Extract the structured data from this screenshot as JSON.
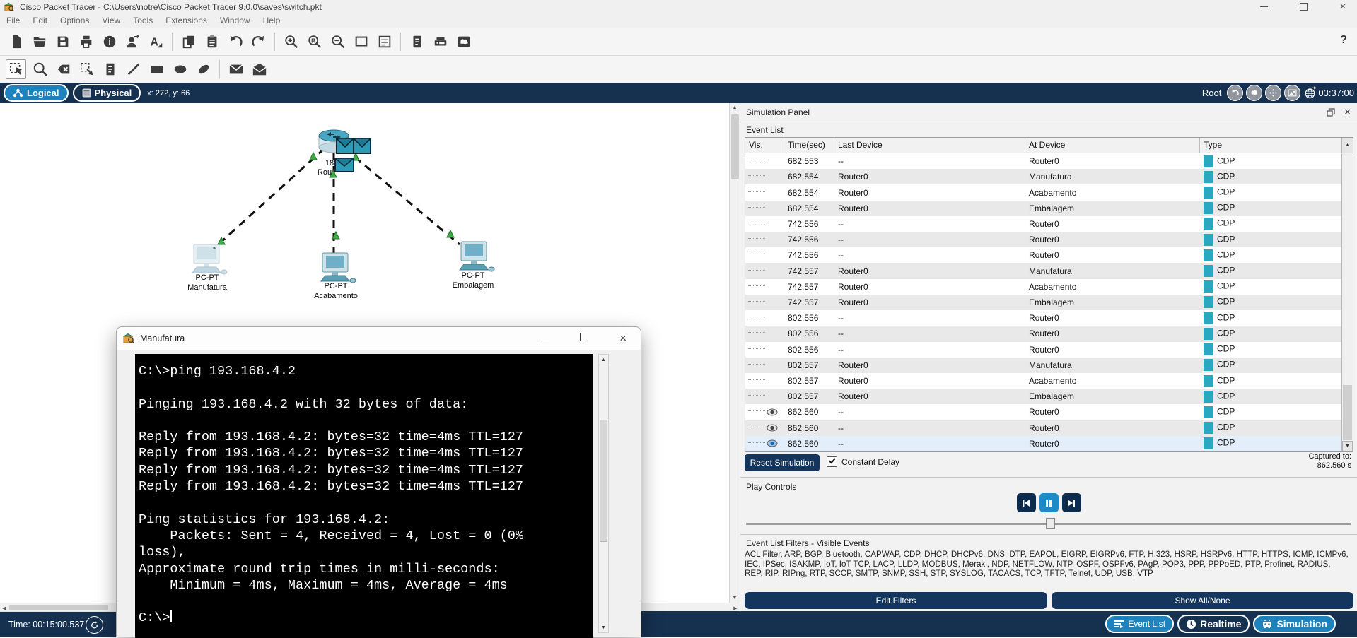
{
  "app": {
    "title": "Cisco Packet Tracer - C:\\Users\\notre\\Cisco Packet Tracer 9.0.0\\saves\\switch.pkt",
    "help_label": "?"
  },
  "menu": {
    "items": [
      "File",
      "Edit",
      "Options",
      "View",
      "Tools",
      "Extensions",
      "Window",
      "Help"
    ]
  },
  "toolbar_main": {
    "icons": [
      "new-file",
      "open-file",
      "save",
      "print",
      "activity-wizard",
      "user-profile",
      "font-settings",
      "|",
      "copy",
      "paste",
      "undo",
      "redo",
      "|",
      "zoom-in",
      "zoom-reset",
      "zoom-out",
      "drawing-palette",
      "custom-devices",
      "|",
      "network-info",
      "device-console",
      "environment"
    ]
  },
  "toolbar_draw": {
    "icons": [
      "select",
      "inspect",
      "delete",
      "resize-shape",
      "place-note",
      "draw-line",
      "draw-rectangle",
      "draw-ellipse",
      "draw-freeform",
      "|",
      "add-simple-pdu",
      "add-complex-pdu"
    ]
  },
  "workspace_bar": {
    "logical": "Logical",
    "physical": "Physical",
    "coords": "x: 272, y: 66",
    "root": "Root",
    "clock": "03:37:00"
  },
  "topology": {
    "router": {
      "label_model_visible": "18",
      "label_name_visible": "Rou"
    },
    "pcs": [
      {
        "type_label": "PC-PT",
        "name": "Manufatura"
      },
      {
        "type_label": "PC-PT",
        "name": "Acabamento"
      },
      {
        "type_label": "PC-PT",
        "name": "Embalagem"
      }
    ]
  },
  "terminal_window": {
    "title": "Manufatura",
    "lines": [
      "C:\\>ping 193.168.4.2",
      "",
      "Pinging 193.168.4.2 with 32 bytes of data:",
      "",
      "Reply from 193.168.4.2: bytes=32 time=4ms TTL=127",
      "Reply from 193.168.4.2: bytes=32 time=4ms TTL=127",
      "Reply from 193.168.4.2: bytes=32 time=4ms TTL=127",
      "Reply from 193.168.4.2: bytes=32 time=4ms TTL=127",
      "",
      "Ping statistics for 193.168.4.2:",
      "    Packets: Sent = 4, Received = 4, Lost = 0 (0%",
      "loss),",
      "Approximate round trip times in milli-seconds:",
      "    Minimum = 4ms, Maximum = 4ms, Average = 4ms",
      "",
      "C:\\>"
    ]
  },
  "simulation_panel": {
    "title": "Simulation Panel",
    "event_list_label": "Event List",
    "columns": [
      "Vis.",
      "Time(sec)",
      "Last Device",
      "At Device",
      "Type"
    ],
    "type_color": "#29a8c0",
    "events": [
      {
        "time": "682.553",
        "last": "--",
        "at": "Router0",
        "type": "CDP",
        "eye": false
      },
      {
        "time": "682.554",
        "last": "Router0",
        "at": "Manufatura",
        "type": "CDP",
        "eye": false
      },
      {
        "time": "682.554",
        "last": "Router0",
        "at": "Acabamento",
        "type": "CDP",
        "eye": false
      },
      {
        "time": "682.554",
        "last": "Router0",
        "at": "Embalagem",
        "type": "CDP",
        "eye": false
      },
      {
        "time": "742.556",
        "last": "--",
        "at": "Router0",
        "type": "CDP",
        "eye": false
      },
      {
        "time": "742.556",
        "last": "--",
        "at": "Router0",
        "type": "CDP",
        "eye": false
      },
      {
        "time": "742.556",
        "last": "--",
        "at": "Router0",
        "type": "CDP",
        "eye": false
      },
      {
        "time": "742.557",
        "last": "Router0",
        "at": "Manufatura",
        "type": "CDP",
        "eye": false
      },
      {
        "time": "742.557",
        "last": "Router0",
        "at": "Acabamento",
        "type": "CDP",
        "eye": false
      },
      {
        "time": "742.557",
        "last": "Router0",
        "at": "Embalagem",
        "type": "CDP",
        "eye": false
      },
      {
        "time": "802.556",
        "last": "--",
        "at": "Router0",
        "type": "CDP",
        "eye": false
      },
      {
        "time": "802.556",
        "last": "--",
        "at": "Router0",
        "type": "CDP",
        "eye": false
      },
      {
        "time": "802.556",
        "last": "--",
        "at": "Router0",
        "type": "CDP",
        "eye": false
      },
      {
        "time": "802.557",
        "last": "Router0",
        "at": "Manufatura",
        "type": "CDP",
        "eye": false
      },
      {
        "time": "802.557",
        "last": "Router0",
        "at": "Acabamento",
        "type": "CDP",
        "eye": false
      },
      {
        "time": "802.557",
        "last": "Router0",
        "at": "Embalagem",
        "type": "CDP",
        "eye": false
      },
      {
        "time": "862.560",
        "last": "--",
        "at": "Router0",
        "type": "CDP",
        "eye": true
      },
      {
        "time": "862.560",
        "last": "--",
        "at": "Router0",
        "type": "CDP",
        "eye": true
      },
      {
        "time": "862.560",
        "last": "--",
        "at": "Router0",
        "type": "CDP",
        "eye": true,
        "current": true
      }
    ],
    "reset_button": "Reset Simulation",
    "constant_delay_label": "Constant Delay",
    "constant_delay_checked": true,
    "captured_to_label": "Captured to:",
    "captured_to_value": "862.560 s",
    "play_controls_label": "Play Controls",
    "filters_title": "Event List Filters - Visible Events",
    "filters_text": "ACL Filter, ARP, BGP, Bluetooth, CAPWAP, CDP, DHCP, DHCPv6, DNS, DTP, EAPOL, EIGRP, EIGRPv6, FTP, H.323, HSRP, HSRPv6, HTTP, HTTPS, ICMP, ICMPv6, IEC, IPSec, ISAKMP, IoT, IoT TCP, LACP, LLDP, MODBUS, Meraki, NDP, NETFLOW, NTP, OSPF, OSPFv6, PAgP, POP3, PPP, PPPoED, PTP, Profinet, RADIUS, REP, RIP, RIPng, RTP, SCCP, SMTP, SNMP, SSH, STP, SYSLOG, TACACS, TCP, TFTP, Telnet, UDP, USB, VTP",
    "edit_filters_button": "Edit Filters",
    "show_all_button": "Show All/None"
  },
  "status_bar": {
    "time_label": "Time: 00:15:00.537",
    "event_list_button": "Event List",
    "realtime_tab": "Realtime",
    "simulation_tab": "Simulation"
  },
  "colors": {
    "accent_blue": "#1e82bd",
    "navy": "#16304f",
    "event_type": "#29a8c0"
  }
}
